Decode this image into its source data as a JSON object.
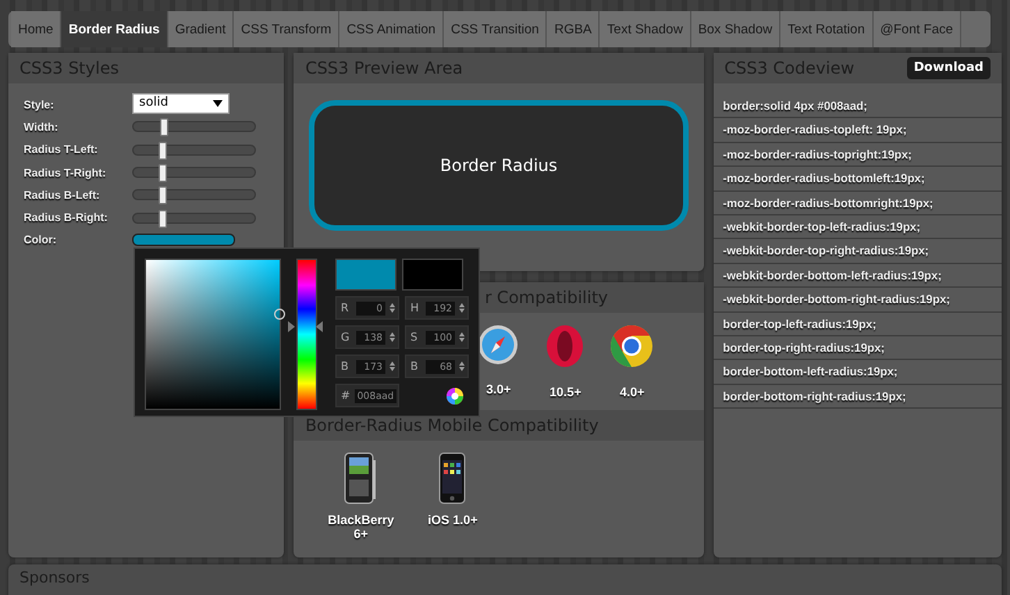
{
  "tabs": [
    {
      "label": "Home",
      "selected": false
    },
    {
      "label": "Border Radius",
      "selected": true
    },
    {
      "label": "Gradient",
      "selected": false
    },
    {
      "label": "CSS Transform",
      "selected": false
    },
    {
      "label": "CSS Animation",
      "selected": false
    },
    {
      "label": "CSS Transition",
      "selected": false
    },
    {
      "label": "RGBA",
      "selected": false
    },
    {
      "label": "Text Shadow",
      "selected": false
    },
    {
      "label": "Box Shadow",
      "selected": false
    },
    {
      "label": "Text Rotation",
      "selected": false
    },
    {
      "label": "@Font Face",
      "selected": false
    }
  ],
  "styles_panel": {
    "title": "CSS3 Styles",
    "controls": [
      {
        "kind": "select",
        "label": "Style:",
        "value": "solid"
      },
      {
        "kind": "slider",
        "label": "Width:",
        "level": 0.25
      },
      {
        "kind": "slider",
        "label": "Radius T-Left:",
        "level": 0.24
      },
      {
        "kind": "slider",
        "label": "Radius T-Right:",
        "level": 0.24
      },
      {
        "kind": "slider",
        "label": "Radius B-Left:",
        "level": 0.24
      },
      {
        "kind": "slider",
        "label": "Radius B-Right:",
        "level": 0.24
      },
      {
        "kind": "color",
        "label": "Color:"
      }
    ]
  },
  "color_picker": {
    "swatches": [
      {
        "color": "#008aad"
      },
      {
        "color": "#000000"
      }
    ],
    "fields": [
      {
        "label": "R",
        "value": "0"
      },
      {
        "label": "H",
        "value": "192"
      },
      {
        "label": "G",
        "value": "138"
      },
      {
        "label": "S",
        "value": "100"
      },
      {
        "label": "B",
        "value": "173"
      },
      {
        "label": "B",
        "value": "68"
      }
    ],
    "hex": {
      "label": "#",
      "value": "008aad"
    },
    "hue": {
      "level": 0.45
    }
  },
  "preview_panel": {
    "title": "CSS3 Preview Area",
    "box_text": "Border Radius"
  },
  "compat_panel": {
    "desktop_title": "r Compatibility",
    "desktop_browsers": [
      {
        "kind": "safari",
        "version": "3.0+"
      },
      {
        "kind": "opera",
        "version": "10.5+"
      },
      {
        "kind": "chrome",
        "version": "4.0+"
      }
    ],
    "mobile_title": "Border-Radius Mobile Compatibility",
    "mobile_devices": [
      {
        "kind": "blackberry",
        "version": "BlackBerry 6+"
      },
      {
        "kind": "iphone",
        "version": "iOS 1.0+"
      }
    ]
  },
  "code_panel": {
    "title": "CSS3 Codeview",
    "button": "Download",
    "lines": [
      "border:solid 4px #008aad;",
      "-moz-border-radius-topleft: 19px;",
      "-moz-border-radius-topright:19px;",
      "-moz-border-radius-bottomleft:19px;",
      "-moz-border-radius-bottomright:19px;",
      "-webkit-border-top-left-radius:19px;",
      "-webkit-border-top-right-radius:19px;",
      "-webkit-border-bottom-left-radius:19px;",
      "-webkit-border-bottom-right-radius:19px;",
      "border-top-left-radius:19px;",
      "border-top-right-radius:19px;",
      "border-bottom-left-radius:19px;",
      "border-bottom-right-radius:19px;"
    ]
  },
  "sponsors": {
    "title": "Sponsors"
  }
}
